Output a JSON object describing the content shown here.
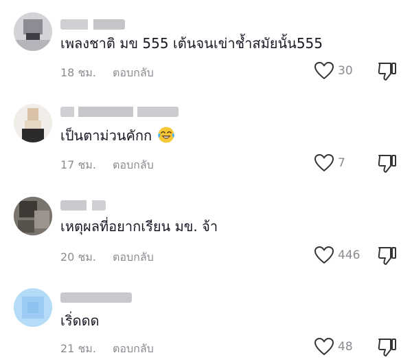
{
  "comments": [
    {
      "text": "เพลงชาติ มข 555 เต้นจนเข่าช้ำสมัยนั้น555",
      "time": "18 ชม.",
      "reply_label": "ตอบกลับ",
      "likes": "30",
      "has_emoji": false
    },
    {
      "text": "เป็นตาม่วนคักก",
      "time": "17 ชม.",
      "reply_label": "ตอบกลับ",
      "likes": "7",
      "has_emoji": true,
      "emoji_icon": "tears-of-joy-emoji-icon"
    },
    {
      "text": "เหตุผลที่อยากเรียน มข. จ้า",
      "time": "20 ชม.",
      "reply_label": "ตอบกลับ",
      "likes": "446",
      "has_emoji": false
    },
    {
      "text": "เริ่ดดด",
      "time": "21 ชม.",
      "reply_label": "ตอบกลับ",
      "likes": "48",
      "has_emoji": false
    }
  ],
  "icons": {
    "like": "heart-outline-icon",
    "dislike": "thumbs-down-icon"
  },
  "colors": {
    "primary_text": "#161823",
    "secondary_text": "#8a8b91",
    "icon_stroke": "#333333",
    "background": "#ffffff"
  }
}
